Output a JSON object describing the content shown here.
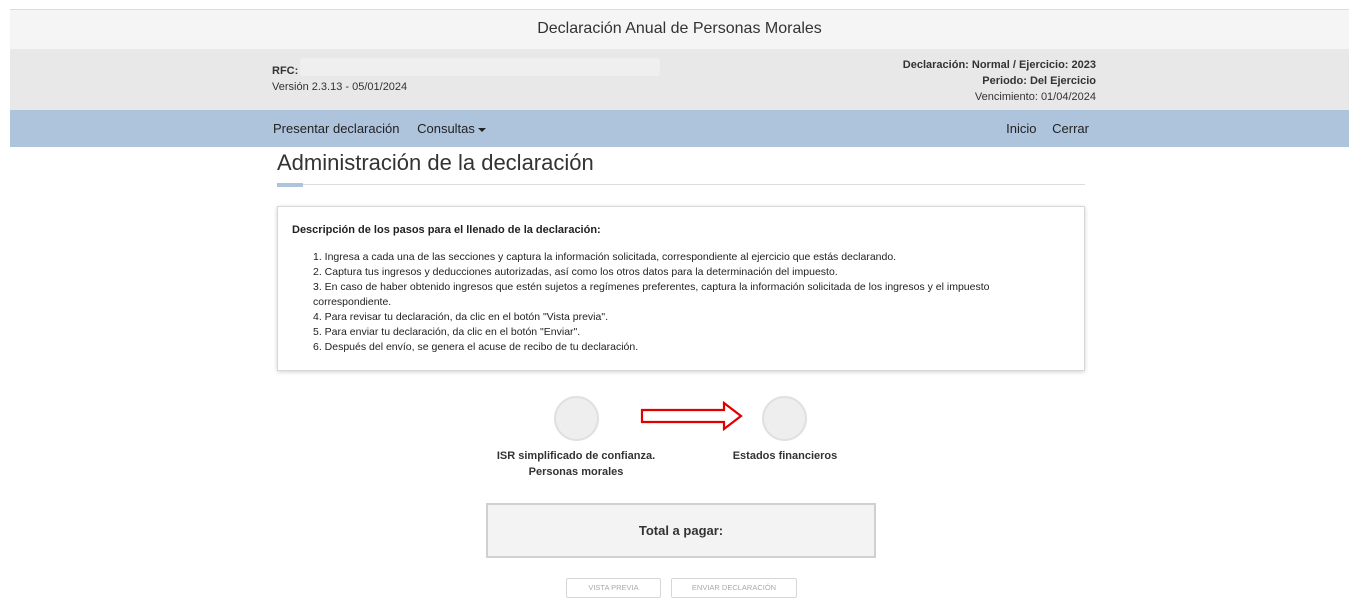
{
  "header": {
    "title": "Declaración Anual de Personas Morales",
    "rfc_label": "RFC:",
    "version": "Versión 2.3.13 - 05/01/2024",
    "declaracion_prefix": "Declaración: Normal / Ejercicio: 2023",
    "periodo": "Periodo: Del Ejercicio",
    "vencimiento": "Vencimiento: 01/04/2024"
  },
  "nav": {
    "presentar": "Presentar declaración",
    "consultas": "Consultas",
    "inicio": "Inicio",
    "cerrar": "Cerrar",
    "bar_color": "#aec4dd"
  },
  "main": {
    "title": "Administración de la declaración",
    "steps_heading": "Descripción de los pasos para el llenado de la declaración:",
    "steps": [
      "1. Ingresa a cada una de las secciones y captura la información solicitada, correspondiente al ejercicio que estás declarando.",
      "2. Captura tus ingresos y deducciones autorizadas, así como los otros datos para la determinación del impuesto.",
      "3. En caso de haber obtenido ingresos que estén sujetos a regímenes preferentes, captura la información solicitada de los ingresos y el impuesto correspondiente.",
      "4. Para revisar tu declaración, da clic en el botón \"Vista previa\".",
      "5. Para enviar tu declaración, da clic en el botón \"Enviar\".",
      "6. Después del envío, se genera el acuse de recibo de tu declaración."
    ],
    "sections": {
      "isr_line1": "ISR simplificado de confianza.",
      "isr_line2": "Personas morales",
      "estados": "Estados financieros"
    },
    "arrow_color": "#e00000",
    "total_label": "Total a pagar:"
  },
  "buttons": {
    "preview": "VISTA PREVIA",
    "send": "ENVIAR DECLARACIÓN"
  }
}
